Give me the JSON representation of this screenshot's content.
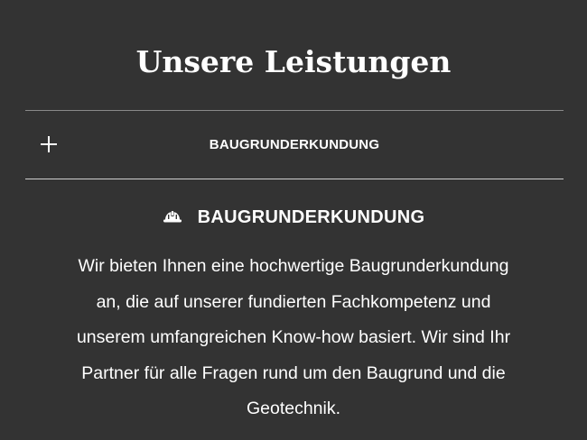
{
  "section": {
    "title": "Unsere Leistungen"
  },
  "accordion": {
    "items": [
      {
        "label": "BAUGRUNDERKUNDUNG",
        "toggle_icon": "plus-icon",
        "panel": {
          "heading_icon": "hardhat-icon",
          "heading": "BAUGRUNDERKUNDUNG",
          "body_lines": [
            "Wir bieten Ihnen eine hochwertige Baugrunderkundung",
            "an, die auf unserer fundierten Fachkompetenz und",
            "unserem umfangreichen Know-how basiert. Wir sind Ihr",
            "Partner für alle Fragen rund um den Baugrund und die",
            "Geotechnik."
          ]
        }
      }
    ]
  },
  "colors": {
    "background": "#333333",
    "text": "#ffffff",
    "divider": "#8a8a8a"
  }
}
